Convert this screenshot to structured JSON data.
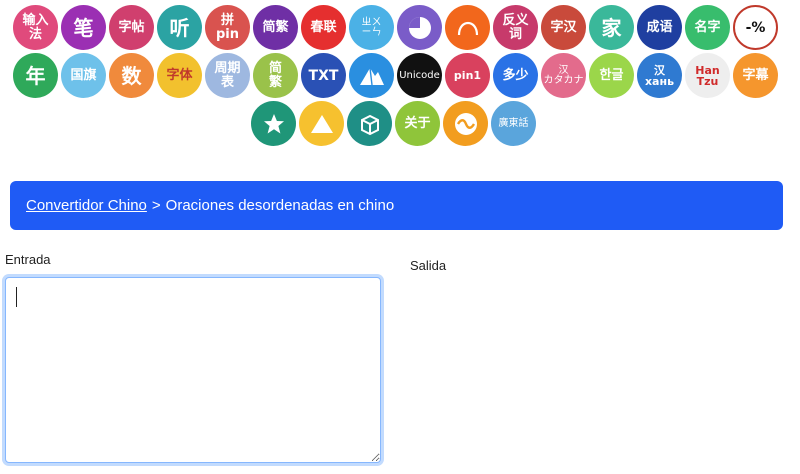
{
  "toolbar": {
    "row1": [
      {
        "name": "input-method-tool",
        "bg": "#e04a7c",
        "lines": [
          "输入",
          "法"
        ],
        "size": "s2"
      },
      {
        "name": "stroke-tool",
        "bg": "#9b2fb3",
        "lines": [
          "笔"
        ],
        "size": "s1"
      },
      {
        "name": "copybook-tool",
        "bg": "#d03f6e",
        "lines": [
          "字帖"
        ],
        "size": "s2"
      },
      {
        "name": "listen-tool",
        "bg": "#2ba3a3",
        "lines": [
          "听"
        ],
        "size": "s1"
      },
      {
        "name": "pinyin-tool",
        "bg": "#d9534f",
        "lines": [
          "拼",
          "pin"
        ],
        "size": "s2"
      },
      {
        "name": "simplified-traditional-tool",
        "bg": "#6f2fa5",
        "lines": [
          "简繁"
        ],
        "size": "s2"
      },
      {
        "name": "spring-couplets-tool",
        "bg": "#e52f2f",
        "lines": [
          "春联"
        ],
        "size": "s2"
      },
      {
        "name": "zhuyin-tool",
        "bg": "#4bb1e6",
        "lines": [
          "ㄓㄨ",
          "ㄧㄣ"
        ],
        "size": "s3"
      },
      {
        "name": "pie-tool",
        "bg": "#7a5cc8",
        "icon": "pie-icon"
      },
      {
        "name": "arc-tool",
        "bg": "#f2671c",
        "icon": "arc-icon"
      },
      {
        "name": "antonym-tool",
        "bg": "#c73a6b",
        "lines": [
          "反义",
          "词"
        ],
        "size": "s2"
      },
      {
        "name": "reverse-text-tool",
        "bg": "#c94a3b",
        "lines": [
          "字汉"
        ],
        "size": "s2"
      },
      {
        "name": "family-tool",
        "bg": "#3ab89a",
        "lines": [
          "家"
        ],
        "size": "s1"
      },
      {
        "name": "idiom-tool",
        "bg": "#1f3fa0",
        "lines": [
          "成语"
        ],
        "size": "s2"
      },
      {
        "name": "names-tool",
        "bg": "#38bd6d",
        "lines": [
          "名字"
        ],
        "size": "s2"
      },
      {
        "name": "percent-tool",
        "bg": "#ffffff",
        "lines": [
          "-%"
        ],
        "size": "s4",
        "color": "#111111",
        "border": "#c0392b"
      }
    ],
    "row2": [
      {
        "name": "year-tool",
        "bg": "#2fa95a",
        "lines": [
          "年"
        ],
        "size": "s1"
      },
      {
        "name": "flags-tool",
        "bg": "#6ec1ea",
        "lines": [
          "国旗"
        ],
        "size": "s2"
      },
      {
        "name": "numbers-tool",
        "bg": "#f08a3c",
        "lines": [
          "数"
        ],
        "size": "s1"
      },
      {
        "name": "font-tool",
        "bg": "#f2c12e",
        "lines": [
          "字体"
        ],
        "size": "s2",
        "color": "#c0392b"
      },
      {
        "name": "weekly-calendar-tool",
        "bg": "#9eb8e0",
        "lines": [
          "周期",
          "表"
        ],
        "size": "s2"
      },
      {
        "name": "traditional-tool",
        "bg": "#9ac24a",
        "lines": [
          "简",
          "繁"
        ],
        "size": "s2"
      },
      {
        "name": "txt-tool",
        "bg": "#2a51b5",
        "lines": [
          "TXT"
        ],
        "size": "s4"
      },
      {
        "name": "mountain-tool",
        "bg": "#2a8fe0",
        "icon": "mountain-icon"
      },
      {
        "name": "unicode-tool",
        "bg": "#111111",
        "lines": [
          "Unicode"
        ],
        "size": "s3"
      },
      {
        "name": "pin1-tool",
        "bg": "#d9415e",
        "lines": [
          "pin1"
        ],
        "size": "s5"
      },
      {
        "name": "duoshao-tool",
        "bg": "#2a72e6",
        "lines": [
          "多少"
        ],
        "size": "s2"
      },
      {
        "name": "katakana-tool",
        "bg": "#e36b8c",
        "lines": [
          "汉",
          "カタカナ"
        ],
        "size": "s3"
      },
      {
        "name": "hangul-tool",
        "bg": "#9bd64a",
        "lines": [
          "한글"
        ],
        "size": "s2"
      },
      {
        "name": "cyrillic-tool",
        "bg": "#2f7ad1",
        "lines": [
          "汉",
          "хань"
        ],
        "size": "s5"
      },
      {
        "name": "hantzu-tool",
        "bg": "#eeeeee",
        "lines": [
          "Han",
          "Tzu"
        ],
        "size": "s5",
        "color": "#d02b2b"
      },
      {
        "name": "subtitles-tool",
        "bg": "#f5962d",
        "lines": [
          "字幕"
        ],
        "size": "s2"
      }
    ],
    "row3": [
      {
        "name": "favorites-tool",
        "bg": "#1f9678",
        "icon": "star-icon"
      },
      {
        "name": "triangle-tool",
        "bg": "#f6c12f",
        "icon": "triangle-icon"
      },
      {
        "name": "cube-tool",
        "bg": "#1f8f86",
        "icon": "cube-icon"
      },
      {
        "name": "about-tool",
        "bg": "#8fc53a",
        "lines": [
          "关于"
        ],
        "size": "s2"
      },
      {
        "name": "wave-tool",
        "bg": "#f29d1f",
        "icon": "wave-icon"
      },
      {
        "name": "cantonese-tool",
        "bg": "#5aa5dc",
        "lines": [
          "廣東話"
        ],
        "size": "s3"
      }
    ]
  },
  "breadcrumb": {
    "home_label": "Convertidor Chino",
    "separator": ">",
    "current": "Oraciones desordenadas en chino"
  },
  "form": {
    "input_label": "Entrada",
    "output_label": "Salida",
    "input_value": "",
    "output_value": ""
  },
  "colors": {
    "breadcrumb_bg": "#1f5bf5",
    "focus_border": "#86b7fe"
  }
}
